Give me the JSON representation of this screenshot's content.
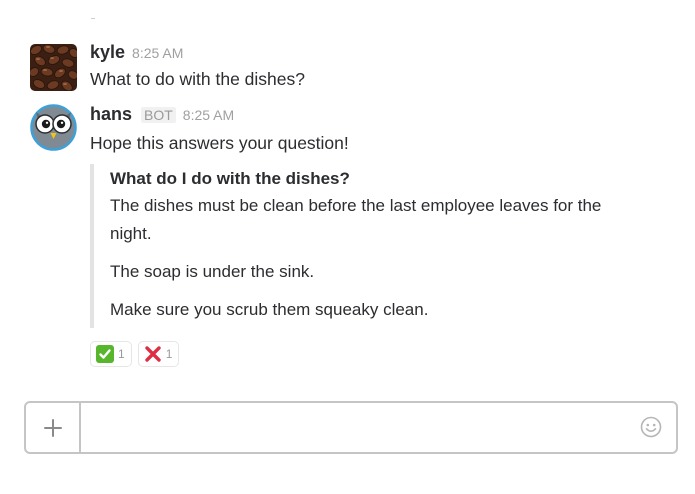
{
  "messages": [
    {
      "username": "kyle",
      "timestamp": "8:25 AM",
      "text": "What to do with the dishes?",
      "avatar_icon": "coffee-beans-avatar"
    },
    {
      "username": "hans",
      "badge": "BOT",
      "timestamp": "8:25 AM",
      "text": "Hope this answers your question!",
      "avatar_icon": "owl-avatar",
      "attachment": {
        "title": "What do I do with the dishes?",
        "paragraphs": [
          "The dishes must be clean before the last employee leaves for the night.",
          "The soap is under the sink.",
          "Make sure you scrub them squeaky clean."
        ]
      },
      "reactions": [
        {
          "icon": "white-check-mark-icon",
          "count": "1",
          "color": "#57b62c"
        },
        {
          "icon": "x-mark-icon",
          "count": "1",
          "color": "#dd2e44"
        }
      ]
    }
  ],
  "composer": {
    "plus_icon": "plus-icon",
    "placeholder": "",
    "value": "",
    "emoji_icon": "smiley-icon"
  }
}
